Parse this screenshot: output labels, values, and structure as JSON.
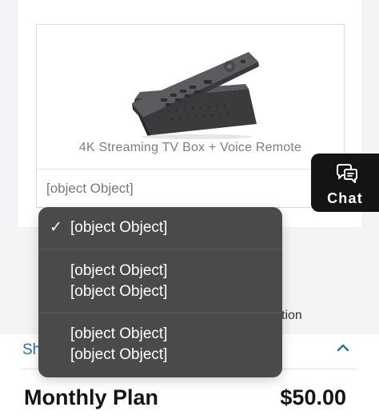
{
  "product": {
    "name": "4K Streaming TV Box + Voice Remote",
    "selected_value": "[object Object]"
  },
  "chat": {
    "label": "Chat"
  },
  "section": {
    "header_text": "Sh",
    "partial_behind_text": "tion"
  },
  "summary": {
    "label": "Monthly Plan",
    "price": "$50.00"
  },
  "dropdown": {
    "checkmark": "✓",
    "options": [
      {
        "lines": [
          "[object Object]"
        ],
        "selected": true
      },
      {
        "lines": [
          "[object Object]",
          "[object Object]"
        ],
        "selected": false
      },
      {
        "lines": [
          "[object Object]",
          "[object Object]"
        ],
        "selected": false
      }
    ]
  },
  "colors": {
    "chat_bg": "#141414",
    "dropdown_bg": "#4a4a4a",
    "link_blue": "#2f6f9a"
  }
}
